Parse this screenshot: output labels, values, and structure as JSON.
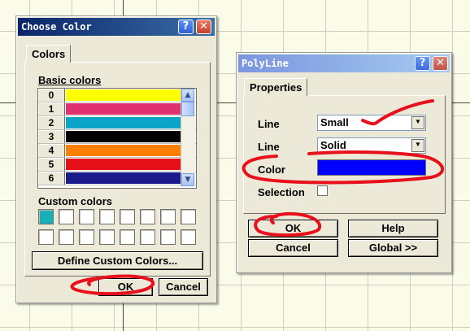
{
  "choose_color": {
    "title": "Choose Color",
    "tab": "Colors",
    "basic_colors_label": "Basic colors",
    "basic_colors": [
      {
        "index": "0",
        "color": "#ffff00"
      },
      {
        "index": "1",
        "color": "#e0306e"
      },
      {
        "index": "2",
        "color": "#0aa4c8"
      },
      {
        "index": "3",
        "color": "#000000"
      },
      {
        "index": "4",
        "color": "#ff8000"
      },
      {
        "index": "5",
        "color": "#e81018"
      },
      {
        "index": "6",
        "color": "#1a1a8c"
      }
    ],
    "custom_colors_label": "Custom colors",
    "custom_first_color": "#18b0b8",
    "define_button": "Define Custom Colors...",
    "ok_button": "OK",
    "cancel_button": "Cancel"
  },
  "polyline": {
    "title": "PolyLine",
    "tab": "Properties",
    "fields": [
      {
        "label": "Line",
        "value": "Small"
      },
      {
        "label": "Line",
        "value": "Solid"
      }
    ],
    "color_label": "Color",
    "color_value": "#0000ff",
    "selection_label": "Selection",
    "ok_button": "OK",
    "help_button": "Help",
    "cancel_button": "Cancel",
    "global_button": "Global >>"
  },
  "annotation_color": "#e8101a"
}
